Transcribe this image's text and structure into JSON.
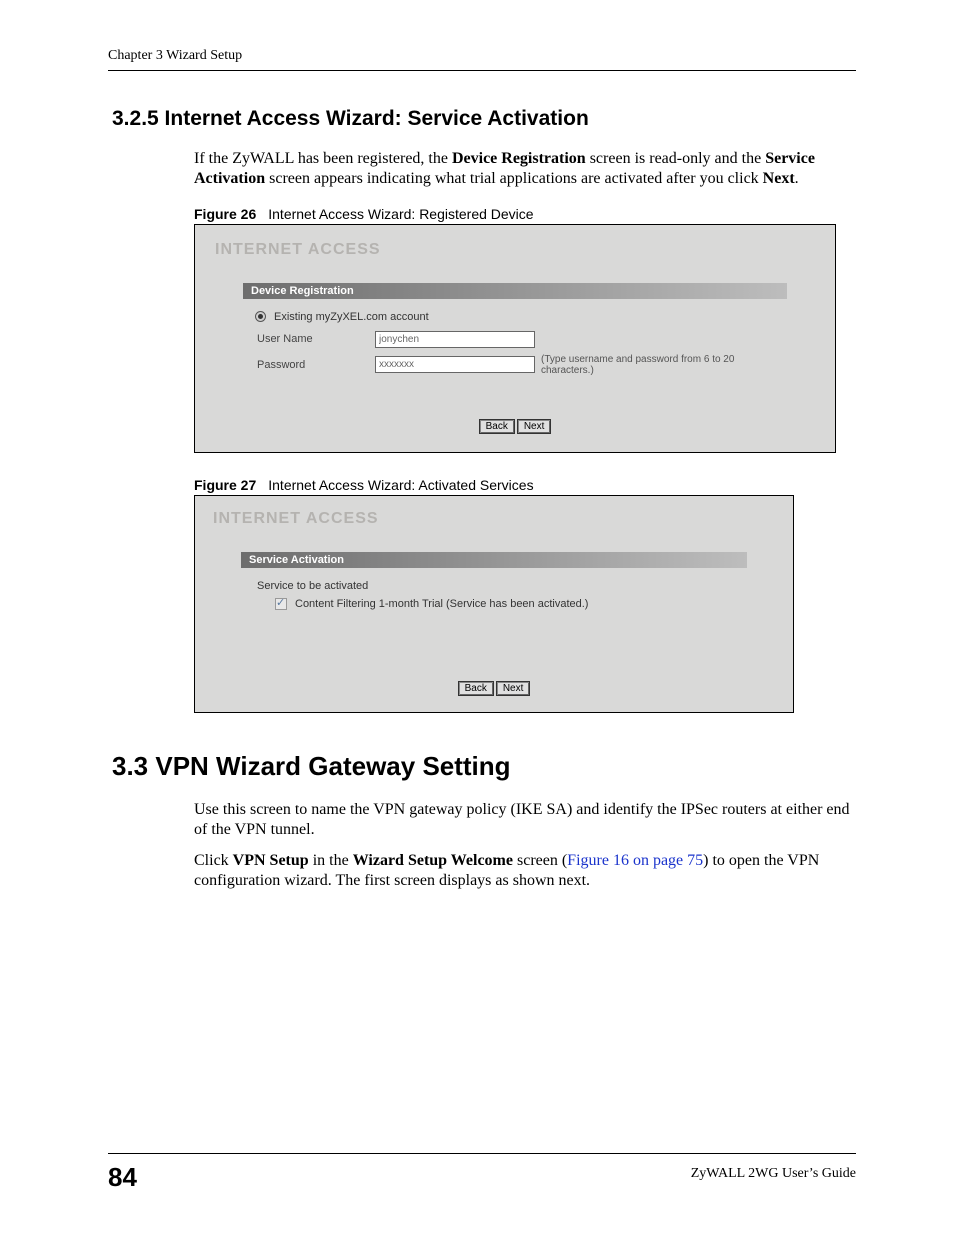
{
  "header": {
    "chapter_line": "Chapter 3 Wizard Setup"
  },
  "section_325": {
    "number_title": "3.2.5  Internet Access Wizard: Service Activation",
    "para1_pre": "If the ZyWALL has been registered, the ",
    "para1_b1": "Device Registration",
    "para1_mid": " screen is read-only and the ",
    "para1_b2": "Service Activation",
    "para1_post": " screen appears indicating what trial applications are activated after you click ",
    "para1_b3": "Next",
    "para1_end": "."
  },
  "fig26": {
    "caption_num": "Figure 26",
    "caption_text": "Internet Access Wizard: Registered Device",
    "wizard_title": "INTERNET ACCESS",
    "section_header": "Device Registration",
    "radio_label": "Existing myZyXEL.com account",
    "username_label": "User Name",
    "username_value": "jonychen",
    "password_label": "Password",
    "password_value": "xxxxxxx",
    "hint": "(Type username and password from 6 to 20 characters.)",
    "btn_back": "Back",
    "btn_next": "Next"
  },
  "fig27": {
    "caption_num": "Figure 27",
    "caption_text": "Internet Access Wizard: Activated Services",
    "wizard_title": "INTERNET ACCESS",
    "section_header": "Service Activation",
    "service_label": "Service to be activated",
    "service_item": "Content Filtering 1-month Trial (Service has been activated.)",
    "btn_back": "Back",
    "btn_next": "Next"
  },
  "section_33": {
    "number_title": "3.3  VPN Wizard Gateway Setting",
    "para1": "Use this screen to name the VPN gateway policy (IKE SA) and identify the IPSec routers at either end of the VPN tunnel.",
    "para2_pre": "Click ",
    "para2_b1": "VPN Setup",
    "para2_mid": " in the ",
    "para2_b2": "Wizard Setup Welcome",
    "para2_post1": " screen (",
    "para2_xref": "Figure 16 on page 75",
    "para2_post2": ") to open the VPN configuration wizard. The first screen displays as shown next."
  },
  "footer": {
    "page_number": "84",
    "doc_title": "ZyWALL 2WG User’s Guide"
  }
}
